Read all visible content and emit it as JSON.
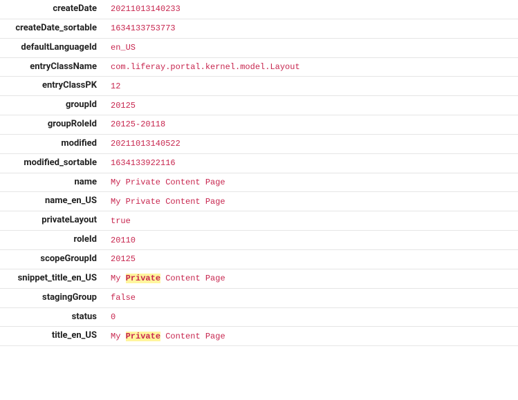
{
  "rows": [
    {
      "key": "createDate",
      "value": "20211013140233"
    },
    {
      "key": "createDate_sortable",
      "value": "1634133753773"
    },
    {
      "key": "defaultLanguageId",
      "value": "en_US"
    },
    {
      "key": "entryClassName",
      "value": "com.liferay.portal.kernel.model.Layout"
    },
    {
      "key": "entryClassPK",
      "value": "12"
    },
    {
      "key": "groupId",
      "value": "20125"
    },
    {
      "key": "groupRoleId",
      "value": "20125-20118"
    },
    {
      "key": "modified",
      "value": "20211013140522"
    },
    {
      "key": "modified_sortable",
      "value": "1634133922116"
    },
    {
      "key": "name",
      "value": "My Private Content Page"
    },
    {
      "key": "name_en_US",
      "value": "My Private Content Page"
    },
    {
      "key": "privateLayout",
      "value": "true"
    },
    {
      "key": "roleId",
      "value": "20110"
    },
    {
      "key": "scopeGroupId",
      "value": "20125"
    },
    {
      "key": "snippet_title_en_US",
      "value_parts": [
        "My ",
        "Private",
        " Content Page"
      ],
      "highlight_index": 1
    },
    {
      "key": "stagingGroup",
      "value": "false"
    },
    {
      "key": "status",
      "value": "0"
    },
    {
      "key": "title_en_US",
      "value_parts": [
        "My ",
        "Private",
        " Content Page"
      ],
      "highlight_index": 1
    }
  ]
}
